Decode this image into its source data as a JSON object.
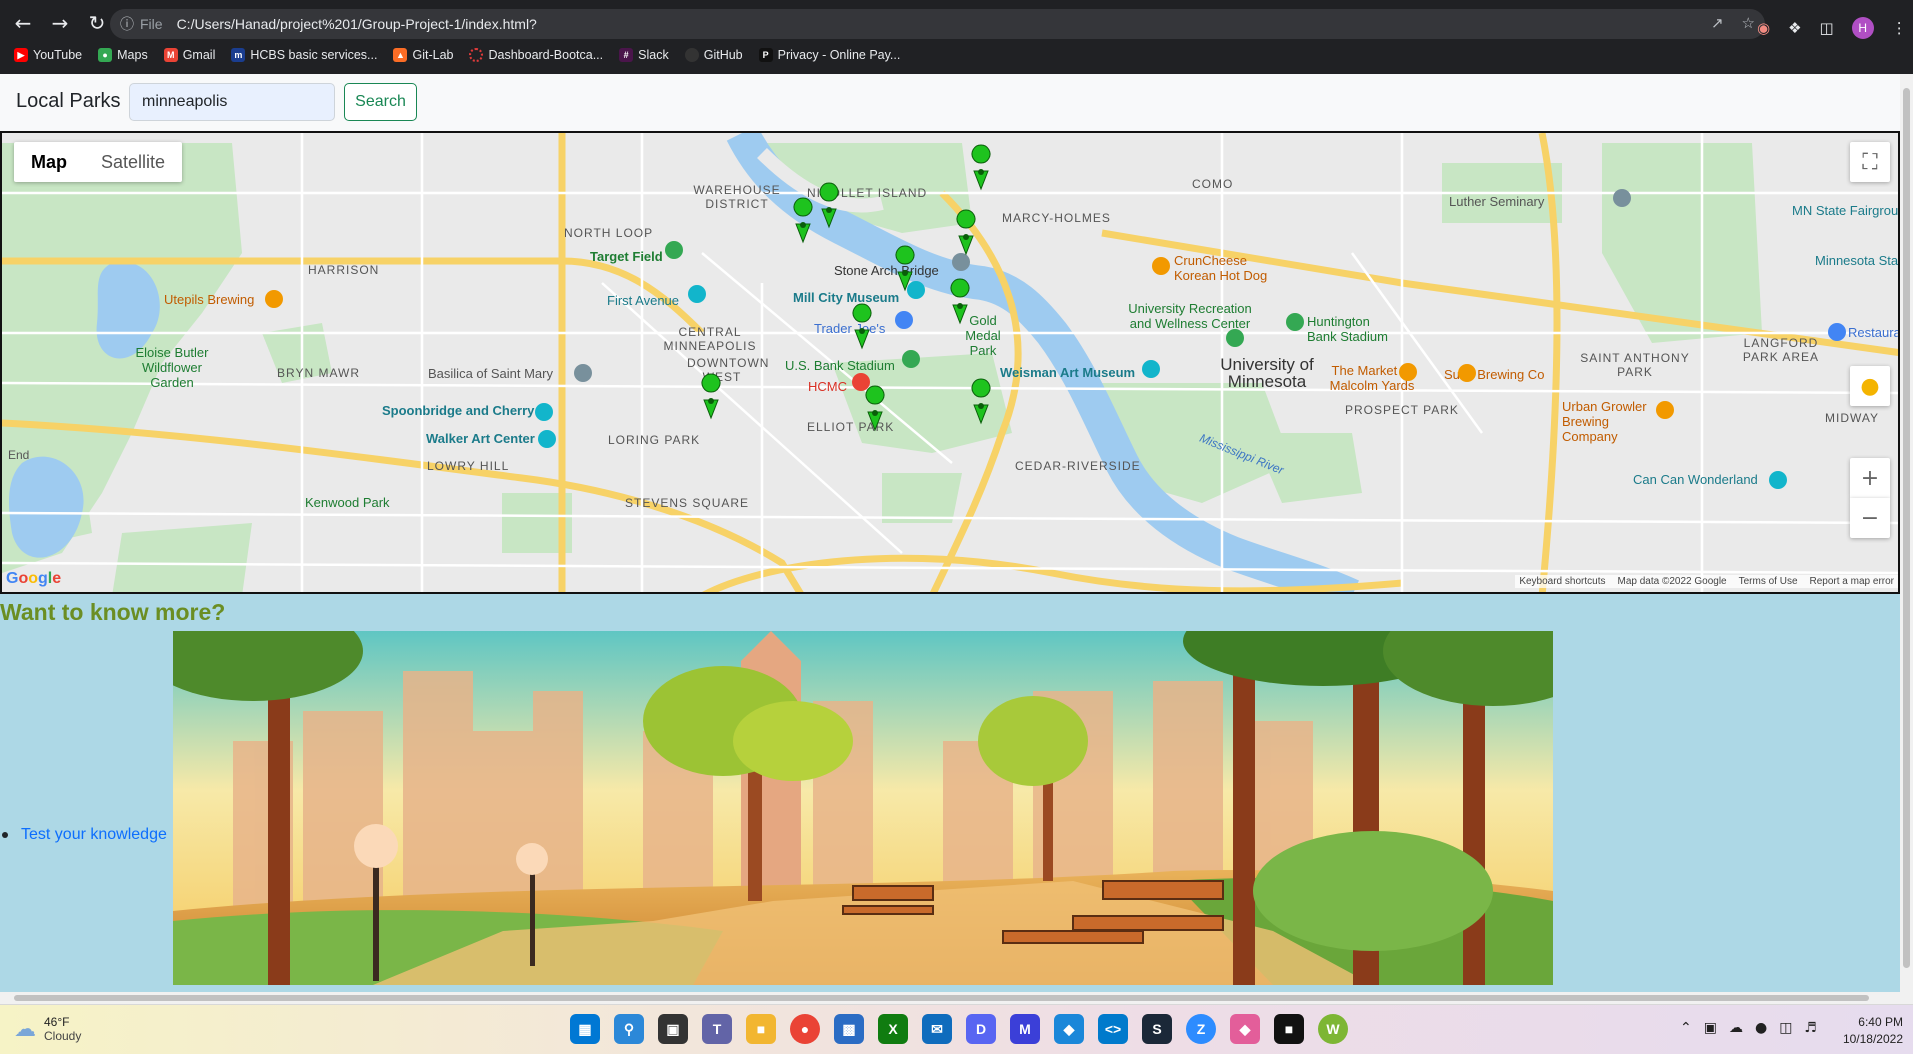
{
  "browser": {
    "file_label": "File",
    "url": "C:/Users/Hanad/project%201/Group-Project-1/index.html?",
    "profile_initial": "H",
    "bookmarks": [
      {
        "label": "YouTube",
        "icon": "youtube-icon",
        "color": "#ff0000"
      },
      {
        "label": "Maps",
        "icon": "maps-icon",
        "color": "#34a853"
      },
      {
        "label": "Gmail",
        "icon": "gmail-icon",
        "color": "#ea4335"
      },
      {
        "label": "HCBS basic services...",
        "icon": "hcbs-icon",
        "color": "#1a3d8f"
      },
      {
        "label": "Git-Lab",
        "icon": "gitlab-icon",
        "color": "#fc6d26"
      },
      {
        "label": "Dashboard-Bootca...",
        "icon": "dashboard-icon",
        "color": "#e03b3b"
      },
      {
        "label": "Slack",
        "icon": "slack-icon",
        "color": "#4a154b"
      },
      {
        "label": "GitHub",
        "icon": "github-icon",
        "color": "#333333"
      },
      {
        "label": "Privacy - Online Pay...",
        "icon": "privacy-icon",
        "color": "#111111"
      }
    ]
  },
  "navbar": {
    "brand": "Local Parks",
    "search_value": "minneapolis",
    "search_button": "Search"
  },
  "map": {
    "type_buttons": [
      "Map",
      "Satellite"
    ],
    "active_type": "Map",
    "attribution": [
      "Keyboard shortcuts",
      "Map data ©2022 Google",
      "Terms of Use",
      "Report a map error"
    ],
    "logo": "Google",
    "labels": {
      "warehouse": "WAREHOUSE DISTRICT",
      "nicollet": "NICOLLET ISLAND",
      "como": "COMO",
      "marcy": "MARCY-HOLMES",
      "north_loop": "NORTH LOOP",
      "harrison": "HARRISON",
      "target_field": "Target Field",
      "stone_arch": "Stone Arch Bridge",
      "first_ave": "First Avenue",
      "mill_city": "Mill City Museum",
      "utepils": "Utepils Brewing",
      "central": "CENTRAL MINNEAPOLIS",
      "downtown": "DOWNTOWN WEST",
      "trader": "Trader Joe's",
      "gold_medal": "Gold Medal Park",
      "eloise": "Eloise Butler Wildflower Garden",
      "bryn": "BRYN MAWR",
      "basilica": "Basilica of Saint Mary",
      "usbank": "U.S. Bank Stadium",
      "hcmc": "HCMC",
      "weisman": "Weisman Art Museum",
      "umn": "University of Minnesota",
      "urwc": "University Recreation and Wellness Center",
      "huntington": "Huntington Bank Stadium",
      "market": "The Market At Malcolm Yards",
      "surly": "Surly Brewing Co",
      "saint_anthony": "SAINT ANTHONY PARK",
      "langford": "LANGFORD PARK AREA",
      "spoonbridge": "Spoonbridge and Cherry",
      "walker": "Walker Art Center",
      "loring": "LORING PARK",
      "elliot": "ELLIOT PARK",
      "cedar": "CEDAR-RIVERSIDE",
      "prospect": "PROSPECT PARK",
      "urban_growler": "Urban Growler Brewing Company",
      "lowry": "LOWRY HILL",
      "kenwood": "Kenwood Park",
      "stevens": "STEVENS SQUARE",
      "mississippi": "Mississippi River",
      "can_can": "Can Can Wonderland",
      "luther": "Luther Seminary",
      "mn_state": "MN State Fairgrounds",
      "crunch": "CrunCheese Korean Hot Dog",
      "midway": "MIDWAY",
      "end": "End",
      "restaura": "Restaura",
      "minnesota_sta": "Minnesota Sta"
    }
  },
  "content": {
    "heading": "Want to know more?",
    "links": [
      "Test your knowledge"
    ]
  },
  "taskbar": {
    "temperature": "46°F",
    "condition": "Cloudy",
    "time": "6:40 PM",
    "date": "10/18/2022"
  },
  "colors": {
    "park_green": "#c8e6c4",
    "marker_green": "#1ec31e",
    "heading_olive": "#6b8e23",
    "page_bg": "#add8e6"
  }
}
